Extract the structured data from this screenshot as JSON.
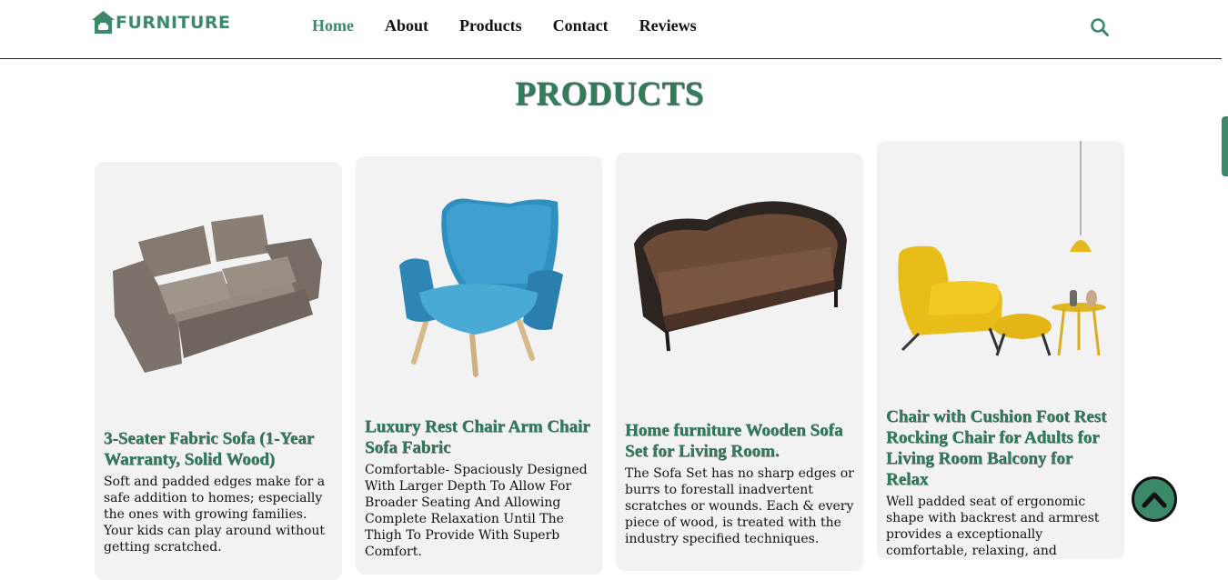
{
  "brand": {
    "name": "FURNITURE",
    "color": "#3a8a69"
  },
  "nav": {
    "items": [
      {
        "label": "Home",
        "active": true
      },
      {
        "label": "About",
        "active": false
      },
      {
        "label": "Products",
        "active": false
      },
      {
        "label": "Contact",
        "active": false
      },
      {
        "label": "Reviews",
        "active": false
      }
    ],
    "search_icon": "search-icon"
  },
  "section": {
    "title": "PRODUCTS"
  },
  "products": [
    {
      "title": "3-Seater Fabric Sofa (1-Year Warranty, Solid Wood)",
      "description": "Soft and padded edges make for a safe addition to homes; especially the ones with growing families. Your kids can play around without getting scratched.",
      "image": "grey-fabric-sofa"
    },
    {
      "title": "Luxury Rest Chair Arm Chair Sofa Fabric",
      "description": "Comfortable- Spaciously Designed With Larger Depth To Allow For Broader Seating And Allowing Complete Relaxation Until The Thigh To Provide With Superb Comfort.",
      "image": "blue-armchair"
    },
    {
      "title": "Home furniture Wooden Sofa Set for Living Room.",
      "description": "The Sofa Set has no sharp edges or burrs to forestall inadvertent scratches or wounds. Each & every piece of wood, is treated with the industry specified techniques.",
      "image": "brown-wooden-sofa"
    },
    {
      "title": "Chair with Cushion Foot Rest Rocking Chair for Adults for Living Room Balcony for Relax",
      "description": "Well padded seat of ergonomic shape with backrest and armrest provides a exceptionally comfortable, relaxing, and",
      "image": "yellow-chair-footrest"
    }
  ],
  "back_to_top": {
    "icon": "chevron-up-icon"
  }
}
